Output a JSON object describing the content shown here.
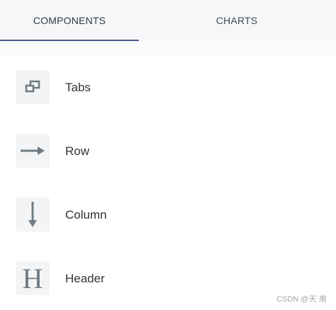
{
  "tabs": [
    {
      "label": "COMPONENTS",
      "active": true
    },
    {
      "label": "CHARTS",
      "active": false
    }
  ],
  "items": [
    {
      "label": "Tabs",
      "icon": "tabs-icon"
    },
    {
      "label": "Row",
      "icon": "arrow-right-icon"
    },
    {
      "label": "Column",
      "icon": "arrow-down-icon"
    },
    {
      "label": "Header",
      "icon": "header-icon"
    }
  ],
  "colors": {
    "active_tab_underline": "#4d5a8b",
    "icon_gray": "#6f7b82",
    "icon_background": "#f3f4f5",
    "tab_bar_background": "#f6f7f8"
  },
  "watermark": "CSDN @天˙南"
}
